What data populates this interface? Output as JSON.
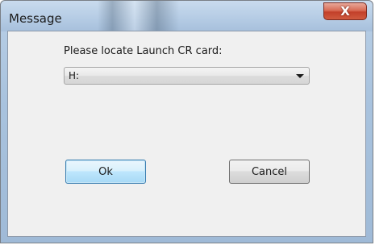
{
  "window": {
    "title": "Message",
    "close_label": "X"
  },
  "prompt": {
    "label": "Please locate Launch CR card:"
  },
  "drive_select": {
    "selected_value": "H:"
  },
  "buttons": {
    "ok_label": "Ok",
    "cancel_label": "Cancel"
  }
}
